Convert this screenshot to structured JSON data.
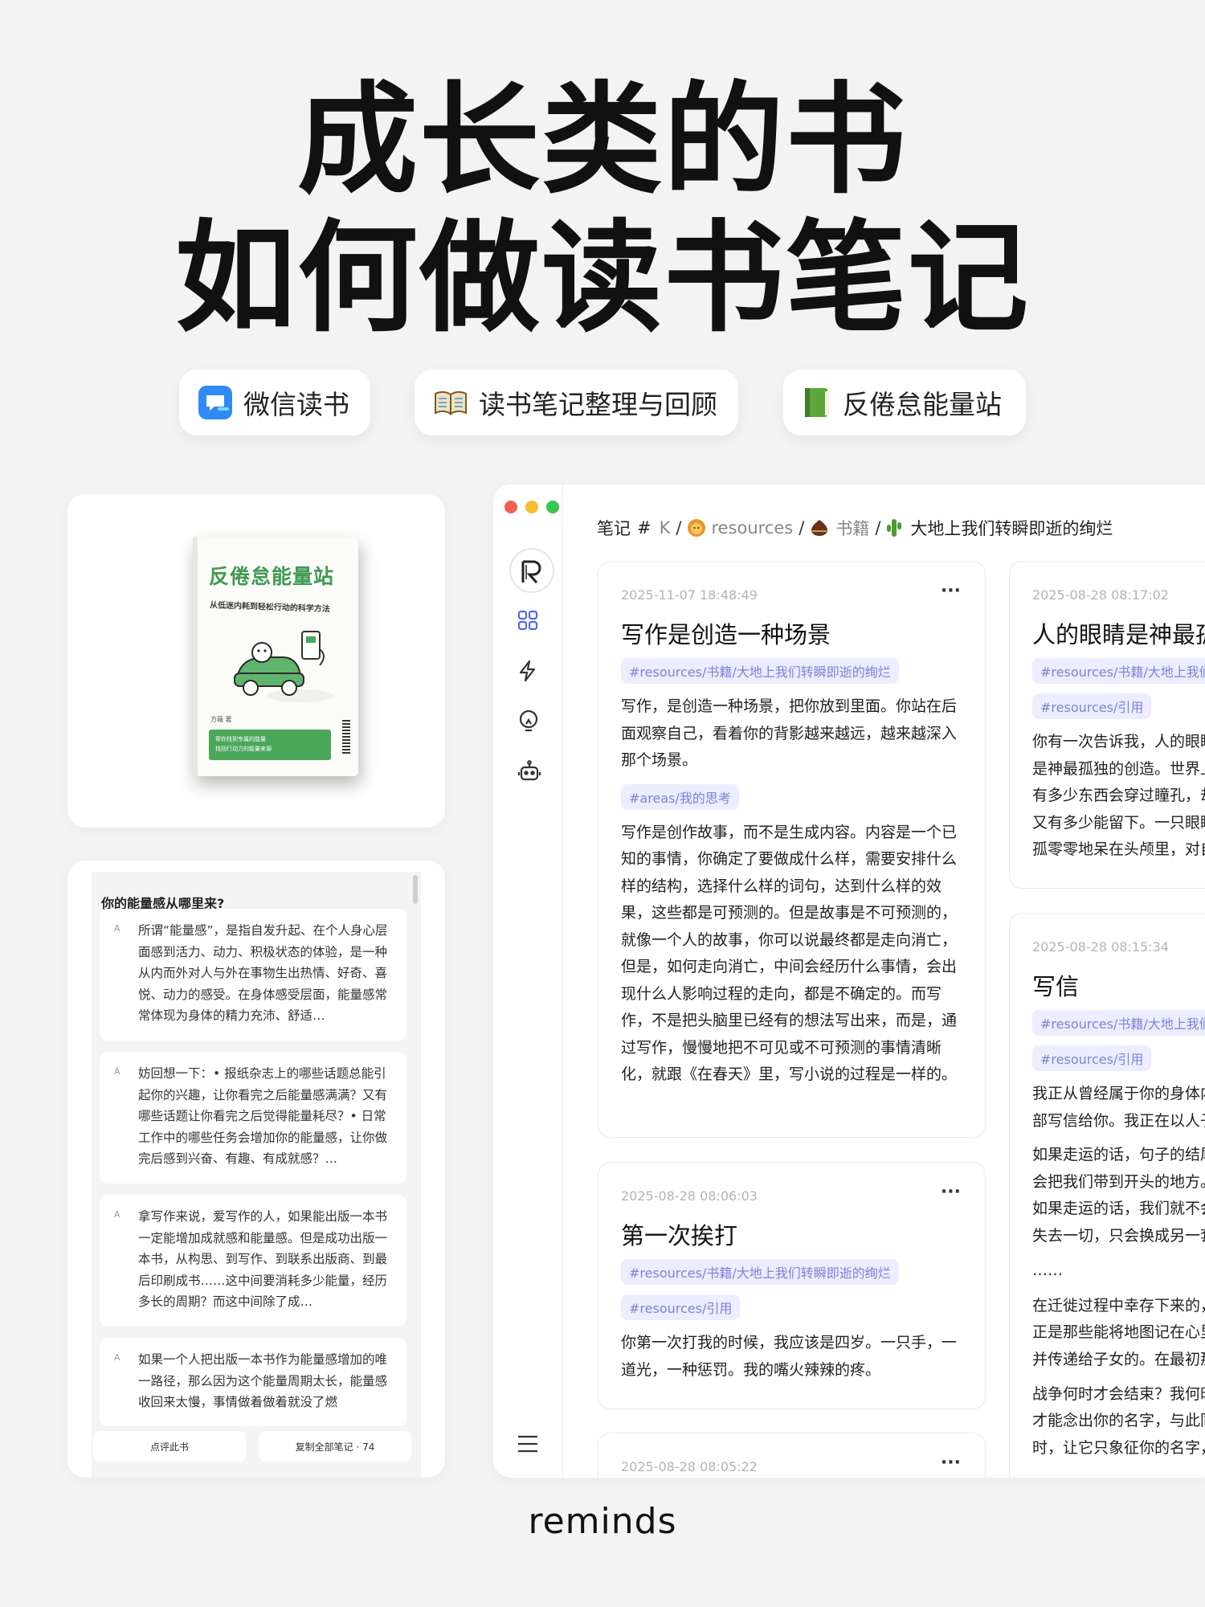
{
  "hero": {
    "line1": "成长类的书",
    "line2": "如何做读书笔记"
  },
  "pills": [
    {
      "icon": "wechat-read-app-icon",
      "label": "微信读书"
    },
    {
      "icon": "open-book-icon",
      "label": "读书笔记整理与回顾"
    },
    {
      "icon": "green-book-icon",
      "label": "反倦怠能量站"
    }
  ],
  "book_cover": {
    "title": "反倦怠能量站",
    "subtitle": "从低迷内耗到轻松行动的科学方法",
    "author": "方薇 著",
    "badge_line1": "帮你找到专属的能量",
    "badge_line2": "找回行动力的能量来源"
  },
  "chat": {
    "heading": "你的能量感从哪里来?",
    "items": [
      {
        "text": "所谓“能量感”，是指自发升起、在个人身心层面感到活力、动力、积极状态的体验，是一种从内而外对人与外在事物生出热情、好奇、喜悦、动力的感受。在身体感受层面，能量感常常体现为身体的精力充沛、舒适…"
      },
      {
        "text": "妨回想一下：• 报纸杂志上的哪些话题总能引起你的兴趣，让你看完之后能量感满满？又有哪些话题让你看完之后觉得能量耗尽？• 日常工作中的哪些任务会增加你的能量感，让你做完后感到兴奋、有趣、有成就感？…"
      },
      {
        "text": "拿写作来说，爱写作的人，如果能出版一本书一定能增加成就感和能量感。但是成功出版一本书，从构思、到写作、到联系出版商、到最后印刷成书……这中间要消耗多少能量，经历多长的周期？而这中间除了成…"
      },
      {
        "text": "如果一个人把出版一本书作为能量感增加的唯一路径，那么因为这个能量周期太长，能量感收回来太慢，事情做着做着就没了燃"
      }
    ],
    "btn_review": "点评此书",
    "btn_copy": "复制全部笔记 · 74"
  },
  "app": {
    "breadcrumb": {
      "notes": "笔记",
      "hash": "#",
      "k": "K",
      "resources": "resources",
      "books": "书籍",
      "book": "大地上我们转瞬即逝的绚烂"
    },
    "notes": [
      {
        "date": "2025-11-07 18:48:49",
        "title": "写作是创造一种场景",
        "tag1": "#resources/书籍/大地上我们转瞬即逝的绚烂",
        "p1": "写作，是创造一种场景，把你放到里面。你站在后面观察自己，看着你的背影越来越远，越来越深入那个场景。",
        "tag2": "#areas/我的思考",
        "p2": "写作是创作故事，而不是生成内容。内容是一个已知的事情，你确定了要做成什么样，需要安排什么样的结构，选择什么样的词句，达到什么样的效果，这些都是可预测的。但是故事是不可预测的，就像一个人的故事，你可以说最终都是走向消亡，但是，如何走向消亡，中间会经历什么事情，会出现什么人影响过程的走向，都是不确定的。而写作，不是把头脑里已经有的想法写出来，而是，通过写作，慢慢地把不可见或不可预测的事情清晰化，就跟《在春天》里，写小说的过程是一样的。"
      },
      {
        "date": "2025-08-28 08:06:03",
        "title": "第一次挨打",
        "tag1": "#resources/书籍/大地上我们转瞬即逝的绚烂",
        "tag2": "#resources/引用",
        "p1": "你第一次打我的时候，我应该是四岁。一只手，一道光，一种惩罚。我的嘴火辣辣的疼。"
      },
      {
        "date": "2025-08-28 08:05:22"
      },
      {
        "date": "2025-08-28 08:17:02",
        "title": "人的眼睛是神最孤独的创造",
        "tag1": "#resources/书籍/大地上我们转瞬即逝的绚烂",
        "tag2": "#resources/引用",
        "p1": "你有一次告诉我，人的眼睛是神最孤独的创造。世界上有多少东西会穿过瞳孔，却又有多少能留下。一只眼睛孤零零地呆在头颅里，对自己之外的东西一无所知，不知道一英寸之外，还有另一只眼睛，在同样饥渴，一样空洞。"
      },
      {
        "date": "2025-08-28 08:15:34",
        "title": "写信",
        "tag1": "#resources/书籍/大地上我们转瞬即逝的绚烂",
        "tag2": "#resources/引用",
        "p1": "我正从曾经属于你的身体内部写信给你。我正在以人子的身份写信给你。",
        "p2": "如果走运的话，句子的结尾会把我们带到开头的地方。如果走运的话，我们就不会失去一切，只会换成另一套用鲜血、肌腱、神经组成的身体，在那里我们的祖先给亲族装满了沉默的推车，它们把我们推向故事中那个没有谁注定要被遗忘的地方。",
        "p3": "……",
        "p4": "在迁徙过程中幸存下来的，正是那些能将地图记在心里并传递给子女的。在最初那个冬天，它们的母亲已经将自己的记忆编进了它们的身体。",
        "p5": "战争何时才会结束？我何时才能念出你的名字，与此同时，让它只象征你的名字，而不象征你身上失去的东西？"
      }
    ]
  },
  "brand": "reminds"
}
